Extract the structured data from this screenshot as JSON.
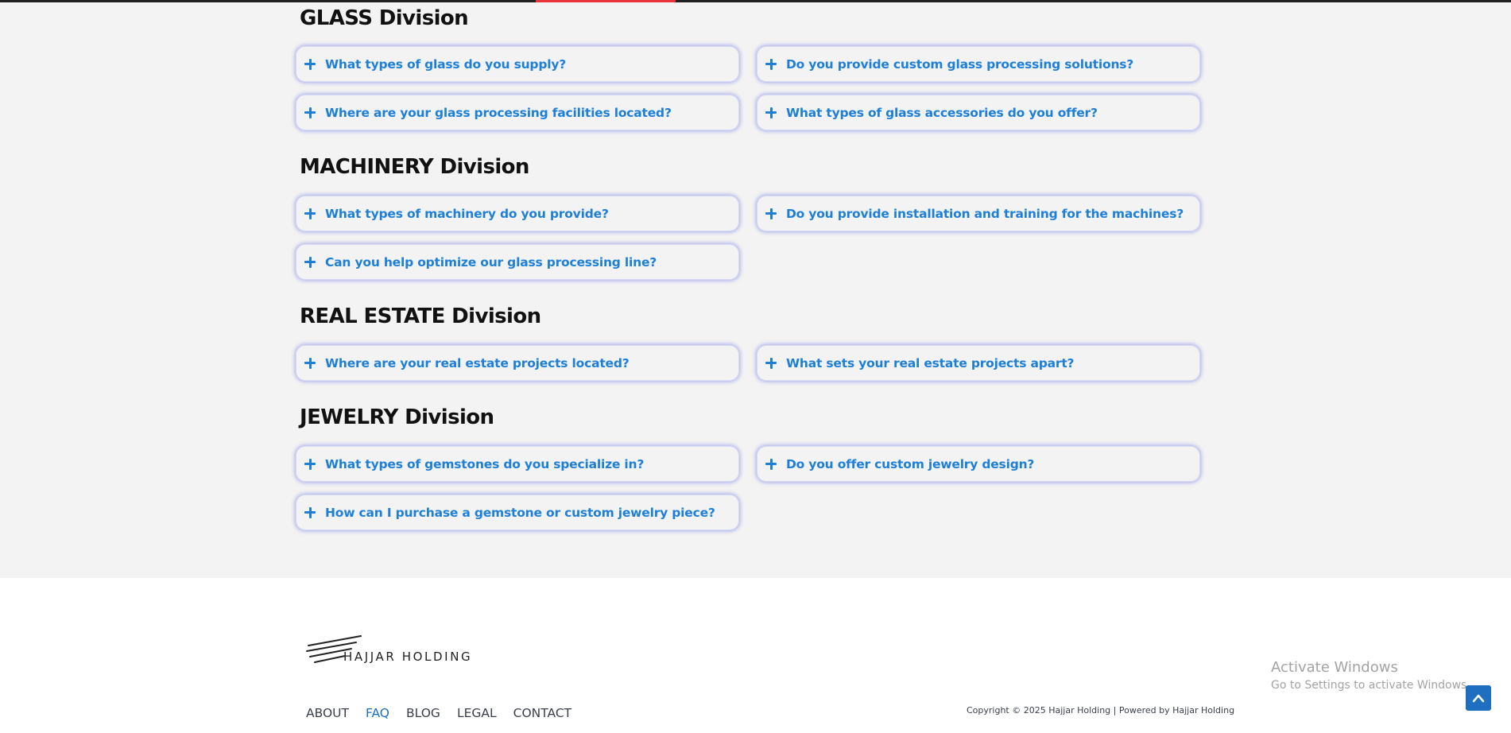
{
  "sections": [
    {
      "title": "GLASS Division",
      "questions": [
        "What types of glass do you supply?",
        "Do you provide custom glass processing solutions?",
        "Where are your glass processing facilities located?",
        "What types of glass accessories do you offer?"
      ]
    },
    {
      "title": "MACHINERY Division",
      "questions": [
        "What types of machinery do you provide?",
        "Do you provide installation and training for the machines?",
        "Can you help optimize our glass processing line?"
      ]
    },
    {
      "title": "REAL ESTATE Division",
      "questions": [
        "Where are your real estate projects located?",
        "What sets your real estate projects apart?"
      ]
    },
    {
      "title": "JEWELRY Division",
      "questions": [
        "What types of gemstones do you specialize in?",
        "Do you offer custom jewelry design?",
        "How can I purchase a gemstone or custom jewelry piece?"
      ]
    }
  ],
  "footer": {
    "logo_text": "HAJJAR HOLDING",
    "nav": [
      "ABOUT",
      "FAQ",
      "BLOG",
      "LEGAL",
      "CONTACT"
    ],
    "active_nav": "FAQ",
    "copyright": "Copyright © 2025 Hajjar Holding | Powered by Hajjar Holding"
  },
  "windows_notice": {
    "title": "Activate Windows",
    "subtitle": "Go to Settings to activate Windows."
  },
  "colors": {
    "accent": "#1e7fd9",
    "progress_bar": "#e8333a",
    "scroll_button": "#1e6fbf"
  },
  "icons": {
    "faq_toggle": "plus-icon",
    "scroll_top": "chevron-up-icon"
  }
}
